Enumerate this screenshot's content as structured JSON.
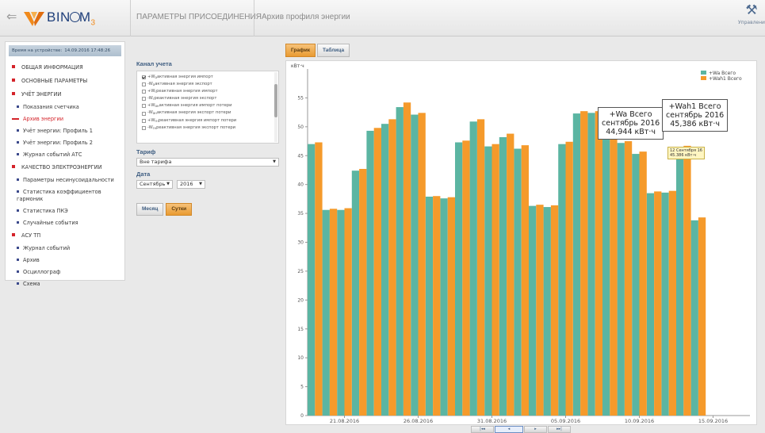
{
  "header": {
    "logo_text": "BIN",
    "logo_sub": "M",
    "logo_idx": "3",
    "crumb_1": "ПАРАМЕТРЫ ПРИСОЕДИНЕНИЯ",
    "crumb_2": "Архив профиля энергии",
    "manage_label": "Управление",
    "accent": "#f08a1c"
  },
  "sidebar": {
    "device_time_label": "Время на устройстве:",
    "device_time_value": "14.09.2016 17:48:26",
    "items": [
      {
        "type": "sec",
        "label": "ОБЩАЯ ИНФОРМАЦИЯ"
      },
      {
        "type": "sec",
        "label": "ОСНОВНЫЕ ПАРАМЕТРЫ"
      },
      {
        "type": "sec",
        "label": "УЧЁТ ЭНЕРГИИ"
      },
      {
        "type": "sub",
        "label": "Показания счетчика"
      },
      {
        "type": "sub",
        "label": "Архив энергии",
        "active": true
      },
      {
        "type": "sub",
        "label": "Учёт энергии: Профиль 1"
      },
      {
        "type": "sub",
        "label": "Учёт энергии: Профиль 2"
      },
      {
        "type": "sub",
        "label": "Журнал событий АТС"
      },
      {
        "type": "sec",
        "label": "КАЧЕСТВО ЭЛЕКТРОЭНЕРГИИ"
      },
      {
        "type": "sub",
        "label": "Параметры несинусоидальности"
      },
      {
        "type": "sub",
        "label": "Статистика коэффициентов гармоник",
        "wrap": true
      },
      {
        "type": "sub",
        "label": "Статистика ПКЭ"
      },
      {
        "type": "sub",
        "label": "Случайные события"
      },
      {
        "type": "sec",
        "label": "АСУ ТП"
      },
      {
        "type": "sub",
        "label": "Журнал событий"
      },
      {
        "type": "sub",
        "label": "Архив"
      },
      {
        "type": "sub",
        "label": "Осциллограф"
      },
      {
        "type": "sub",
        "label": "Схема"
      }
    ]
  },
  "controls": {
    "channel_label": "Канал учета",
    "channels": [
      {
        "label": "+W",
        "sub": "a",
        "rest": " активная энергия импорт",
        "checked": true
      },
      {
        "label": "-W",
        "sub": "a",
        "rest": " активная энергия экспорт",
        "checked": false
      },
      {
        "label": "+W",
        "sub": "r",
        "rest": " реактивная энергия импорт",
        "checked": false
      },
      {
        "label": "-W",
        "sub": "r",
        "rest": " реактивная энергия экспорт",
        "checked": false
      },
      {
        "label": "+W",
        "sub": "ан",
        "rest": " активная энергия импорт потери",
        "checked": false
      },
      {
        "label": "-W",
        "sub": "ан",
        "rest": " активная энергия экспорт потери",
        "checked": false
      },
      {
        "label": "+W",
        "sub": "rн",
        "rest": " реактивная энергия импорт потери",
        "checked": false
      },
      {
        "label": "-W",
        "sub": "rн",
        "rest": " реактивная энергия экспорт потери",
        "checked": false
      }
    ],
    "tariff_label": "Тариф",
    "tariff_value": "Вне тарифа",
    "date_label": "Дата",
    "month_value": "Сентябрь",
    "year_value": "2016",
    "btn_month": "Месяц",
    "btn_day": "Сутки"
  },
  "view_tabs": {
    "graph": "График",
    "table": "Таблица"
  },
  "callouts": {
    "wa": [
      "+Wa Всего",
      "сентябрь 2016",
      "44,944 кВт·ч"
    ],
    "wah": [
      "+Wah1 Всего",
      "сентябрь 2016",
      "45,386 кВт·ч"
    ],
    "tooltip": [
      "12 Сентября 16",
      "45.386 кВт·ч"
    ]
  },
  "nav": [
    "|◂◂",
    "◂",
    "▸",
    "▸▸|"
  ],
  "chart_data": {
    "type": "bar",
    "ylabel": "кВт·ч",
    "ylim": [
      0,
      60
    ],
    "yticks": [
      0,
      5,
      10,
      15,
      20,
      25,
      30,
      35,
      40,
      45,
      50,
      55
    ],
    "grid": false,
    "legend_position": "top-right",
    "x_tick_labels": [
      "21.08.2016",
      "26.08.2016",
      "31.08.2016",
      "05.09.2016",
      "10.09.2016",
      "15.09.2016"
    ],
    "x_tick_index": [
      2,
      7,
      12,
      17,
      22,
      27
    ],
    "series": [
      {
        "name": "+Wa Всего",
        "color": "#5bb5a2",
        "values": [
          47.0,
          35.6,
          35.6,
          42.4,
          49.3,
          50.5,
          53.4,
          52.1,
          37.9,
          37.6,
          47.3,
          50.9,
          46.6,
          48.2,
          46.2,
          36.3,
          36.1,
          47.0,
          52.3,
          52.4,
          52.1,
          47.2,
          45.3,
          38.5,
          38.6,
          45.3,
          33.8,
          0,
          0,
          0
        ]
      },
      {
        "name": "+Wah1 Всего",
        "color": "#f59a2b",
        "values": [
          47.3,
          35.8,
          35.9,
          42.7,
          49.8,
          51.3,
          54.2,
          52.4,
          38.0,
          37.8,
          47.6,
          51.3,
          47.0,
          48.8,
          46.8,
          36.5,
          36.4,
          47.4,
          52.7,
          52.7,
          52.3,
          47.5,
          45.7,
          38.8,
          38.9,
          46.7,
          34.3,
          0,
          0,
          0
        ]
      }
    ]
  }
}
